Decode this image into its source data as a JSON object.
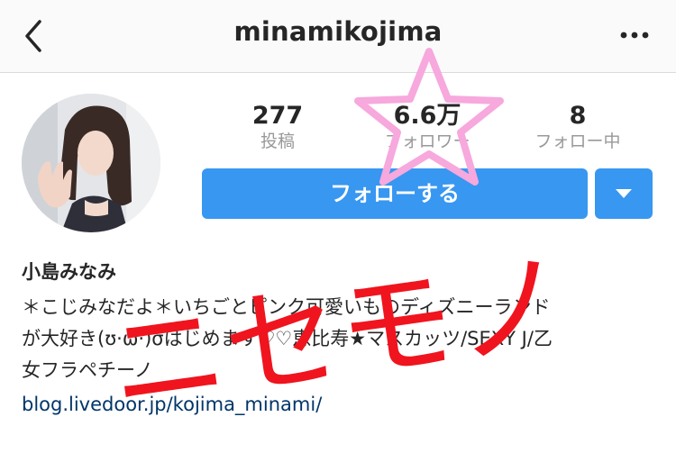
{
  "header": {
    "title": "minamikojima",
    "back_icon": "chevron-left-icon",
    "more_icon": "ellipsis-horizontal-icon"
  },
  "stats": [
    {
      "value": "277",
      "label": "投稿"
    },
    {
      "value": "6.6万",
      "label": "フォロワー"
    },
    {
      "value": "8",
      "label": "フォロー中"
    }
  ],
  "actions": {
    "follow_label": "フォローする",
    "dropdown_icon": "caret-down-icon"
  },
  "profile": {
    "name": "小島みなみ",
    "bio_lines": [
      "＊こじみなだよ＊いちごとピンク可愛いものディズニーランド",
      "が大好き(ʊ·ω·)σはじめます♡♡恵比寿★マスカッツ/SEXY J/乙",
      "女フラペチーノ"
    ],
    "link": "blog.livedoor.jp/kojima_minami/"
  },
  "annotations": {
    "red_text": "ニセモノ",
    "star_icon": "pink-star-outline"
  },
  "colors": {
    "accent": "#3897f0",
    "link": "#003569",
    "muted": "#999999",
    "annotation_red": "#f0141e",
    "annotation_pink": "#f7a8dd"
  }
}
